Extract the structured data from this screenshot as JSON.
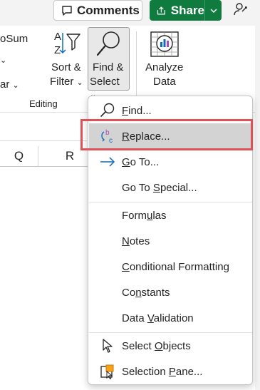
{
  "topbar": {
    "comments_label": "Comments",
    "share_label": "Share"
  },
  "ribbon": {
    "autosum_partial": "oSum",
    "fill_partial": "ar",
    "sort_filter": {
      "line1": "Sort &",
      "line2": "Filter"
    },
    "find_select": {
      "line1": "Find &",
      "line2": "Select"
    },
    "analyze_data": {
      "line1": "Analyze",
      "line2": "Data"
    },
    "group_label": "Editing"
  },
  "grid": {
    "columns": [
      "Q",
      "R"
    ]
  },
  "menu": {
    "items": [
      {
        "label": "Find...",
        "accel": "F",
        "icon": "search-icon"
      },
      {
        "label": "Replace...",
        "accel": "R",
        "icon": "replace-icon",
        "highlighted": true
      },
      {
        "label": "Go To...",
        "accel": "G",
        "icon": "arrow-right-icon"
      },
      {
        "label": "Go To Special...",
        "accel": "S",
        "icon": ""
      },
      {
        "label": "Formulas",
        "accel": "u",
        "icon": ""
      },
      {
        "label": "Notes",
        "accel": "N",
        "icon": ""
      },
      {
        "label": "Conditional Formatting",
        "accel": "C",
        "icon": ""
      },
      {
        "label": "Constants",
        "accel": "n",
        "icon": ""
      },
      {
        "label": "Data Validation",
        "accel": "V",
        "icon": ""
      },
      {
        "label": "Select Objects",
        "accel": "O",
        "icon": "cursor-icon"
      },
      {
        "label": "Selection Pane...",
        "accel": "P",
        "icon": "selection-pane-icon"
      }
    ]
  },
  "colors": {
    "share_green": "#0f7b3f",
    "highlight_red": "#e0525a",
    "hover_gray": "#d3d3d3",
    "accent_blue": "#0f6cbd",
    "icon_purple": "#b146c2"
  }
}
